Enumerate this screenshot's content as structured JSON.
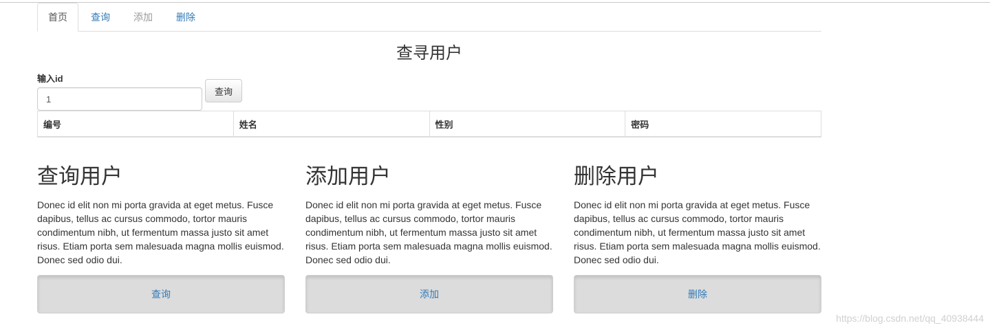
{
  "tabs": [
    {
      "label": "首页",
      "state": "active"
    },
    {
      "label": "查询",
      "state": "normal"
    },
    {
      "label": "添加",
      "state": "disabled"
    },
    {
      "label": "删除",
      "state": "normal"
    }
  ],
  "search": {
    "title": "查寻用户",
    "label": "输入id",
    "value": "1",
    "button_label": "查询"
  },
  "table": {
    "headers": [
      "编号",
      "姓名",
      "性别",
      "密码"
    ]
  },
  "cards": [
    {
      "title": "查询用户",
      "text": "Donec id elit non mi porta gravida at eget metus. Fusce dapibus, tellus ac cursus commodo, tortor mauris condimentum nibh, ut fermentum massa justo sit amet risus. Etiam porta sem malesuada magna mollis euismod. Donec sed odio dui.",
      "button_label": "查询"
    },
    {
      "title": "添加用户",
      "text": "Donec id elit non mi porta gravida at eget metus. Fusce dapibus, tellus ac cursus commodo, tortor mauris condimentum nibh, ut fermentum massa justo sit amet risus. Etiam porta sem malesuada magna mollis euismod. Donec sed odio dui.",
      "button_label": "添加"
    },
    {
      "title": "删除用户",
      "text": "Donec id elit non mi porta gravida at eget metus. Fusce dapibus, tellus ac cursus commodo, tortor mauris condimentum nibh, ut fermentum massa justo sit amet risus. Etiam porta sem malesuada magna mollis euismod. Donec sed odio dui.",
      "button_label": "删除"
    }
  ],
  "watermark": "https://blog.csdn.net/qq_40938444",
  "colors": {
    "link": "#337ab7",
    "disabled": "#999999",
    "border": "#dddddd"
  }
}
